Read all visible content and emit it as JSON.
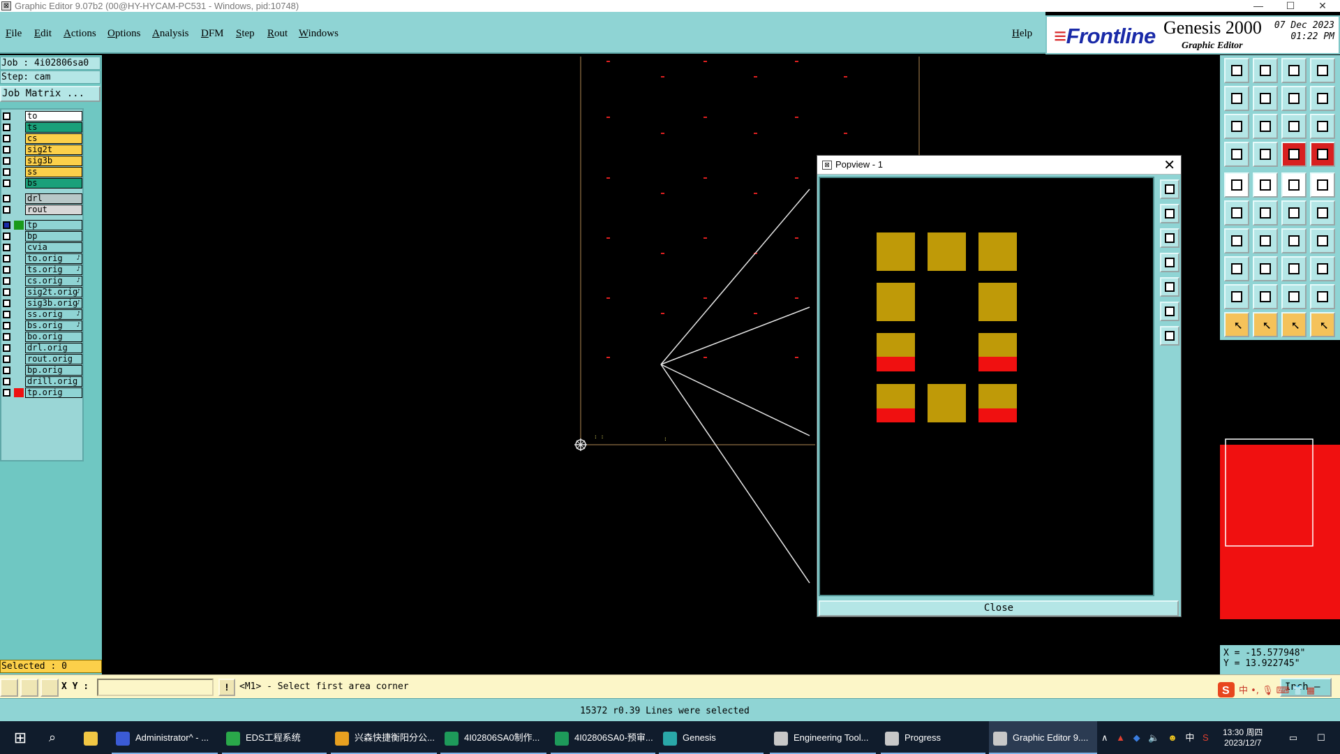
{
  "window": {
    "title": "Graphic Editor 9.07b2 (00@HY-HYCAM-PC531 - Windows, pid:10748)",
    "controls": [
      "—",
      "☐",
      "✕"
    ]
  },
  "menu": {
    "items": [
      "File",
      "Edit",
      "Actions",
      "Options",
      "Analysis",
      "DFM",
      "Step",
      "Rout",
      "Windows"
    ],
    "help": "Help"
  },
  "brand": {
    "logo": "Frontline",
    "product": "Genesis 2000",
    "subtitle": "Graphic Editor",
    "date_line1": "07 Dec 2023",
    "date_line2": "01:22 PM"
  },
  "left_panel": {
    "job": "Job : 4i02806sa0",
    "step": "Step: cam",
    "job_matrix": "Job Matrix ...",
    "selected": "Selected : 0",
    "layers": [
      {
        "name": "to",
        "swatch": "",
        "fill": "#ffffff"
      },
      {
        "name": "ts",
        "swatch": "",
        "fill": "#1aa07a"
      },
      {
        "name": "cs",
        "swatch": "",
        "fill": "#fcd04a"
      },
      {
        "name": "sig2t",
        "swatch": "",
        "fill": "#fcd04a"
      },
      {
        "name": "sig3b",
        "swatch": "",
        "fill": "#fcd04a"
      },
      {
        "name": "ss",
        "swatch": "",
        "fill": "#fcd04a"
      },
      {
        "name": "bs",
        "swatch": "",
        "fill": "#1aa07a"
      },
      {
        "name": "drl",
        "swatch": "",
        "fill": "#b8c8c8",
        "gap": true
      },
      {
        "name": "rout",
        "swatch": "",
        "fill": "#d8d8d8"
      },
      {
        "name": "tp",
        "swatch": "#1a9a1a",
        "fill": "#8fd4d4",
        "gap": true,
        "active": true
      },
      {
        "name": "bp",
        "swatch": "",
        "fill": "#8fd4d4"
      },
      {
        "name": "cvia",
        "swatch": "",
        "fill": "#8fd4d4"
      },
      {
        "name": "to.orig",
        "swatch": "",
        "fill": "#8fd4d4",
        "tag": "♪"
      },
      {
        "name": "ts.orig",
        "swatch": "",
        "fill": "#8fd4d4",
        "tag": "♪"
      },
      {
        "name": "cs.orig",
        "swatch": "",
        "fill": "#8fd4d4",
        "tag": "♪"
      },
      {
        "name": "sig2t.orig",
        "swatch": "",
        "fill": "#8fd4d4",
        "tag": "♪"
      },
      {
        "name": "sig3b.orig",
        "swatch": "",
        "fill": "#8fd4d4",
        "tag": "♪"
      },
      {
        "name": "ss.orig",
        "swatch": "",
        "fill": "#8fd4d4",
        "tag": "♪"
      },
      {
        "name": "bs.orig",
        "swatch": "",
        "fill": "#8fd4d4",
        "tag": "♪"
      },
      {
        "name": "bo.orig",
        "swatch": "",
        "fill": "#8fd4d4"
      },
      {
        "name": "drl.orig",
        "swatch": "",
        "fill": "#8fd4d4"
      },
      {
        "name": "rout.orig",
        "swatch": "",
        "fill": "#8fd4d4"
      },
      {
        "name": "bp.orig",
        "swatch": "",
        "fill": "#8fd4d4"
      },
      {
        "name": "drill.orig",
        "swatch": "",
        "fill": "#8fd4d4"
      },
      {
        "name": "tp.orig",
        "swatch": "#ee1111",
        "fill": "#8fd4d4"
      }
    ]
  },
  "popview": {
    "title": "Popview - 1",
    "close_label": "Close"
  },
  "coords": {
    "x": "X = -15.577948\"",
    "y": "Y = 13.922745\""
  },
  "command": {
    "xy_label": "X Y :",
    "xy_value": "",
    "bang": "!",
    "prompt": "<M1> - Select first area corner",
    "unit": "Inch —"
  },
  "status": {
    "message": "15372 r0.39 Lines were selected"
  },
  "taskbar": {
    "items": [
      {
        "label": "Administrator^ - ...",
        "color": "#3b5bd6"
      },
      {
        "label": "EDS工程系统",
        "color": "#2aa84a"
      },
      {
        "label": "兴森快捷衡阳分公...",
        "color": "#e8a020"
      },
      {
        "label": "4I02806SA0制作...",
        "color": "#1e9a5a"
      },
      {
        "label": "4I02806SA0-预审...",
        "color": "#1e9a5a"
      },
      {
        "label": "Genesis",
        "color": "#2aa8a8"
      },
      {
        "label": "Engineering Tool...",
        "color": "#c8c8c8"
      },
      {
        "label": "Progress",
        "color": "#c8c8c8"
      },
      {
        "label": "Graphic Editor 9....",
        "color": "#c8c8c8",
        "active": true
      }
    ],
    "time": "13:30 周四",
    "date": "2023/12/7",
    "ime": "中"
  }
}
